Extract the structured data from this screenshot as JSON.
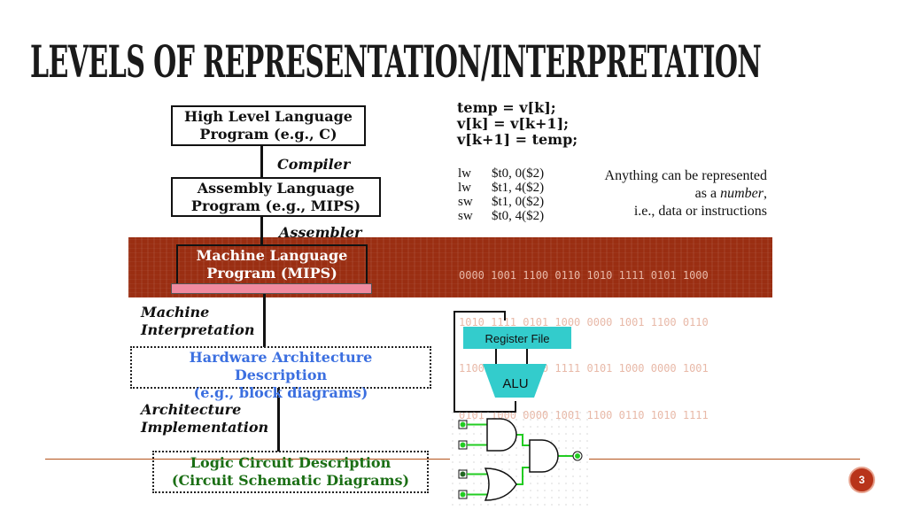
{
  "slide": {
    "title": "LEVELS OF REPRESENTATION/INTERPRETATION",
    "page_number": "3"
  },
  "hierarchy": {
    "high_level": [
      "High Level Language",
      "Program (e.g., C)"
    ],
    "compiler": "Compiler",
    "assembly": [
      "Assembly  Language",
      "Program (e.g., MIPS)"
    ],
    "assembler": "Assembler",
    "machine": [
      "Machine  Language",
      "Program (MIPS)"
    ],
    "machine_interp": [
      "Machine",
      "Interpretation"
    ],
    "hardware": [
      "Hardware Architecture",
      "Description",
      "(e.g., block diagrams)"
    ],
    "arch_impl": [
      "Architecture",
      "Implementation"
    ],
    "logic": [
      "Logic Circuit Description",
      "(Circuit Schematic Diagrams)"
    ]
  },
  "c_code": [
    "temp = v[k];",
    "v[k] = v[k+1];",
    "v[k+1] = temp;"
  ],
  "asm_code": [
    {
      "op": "lw",
      "args": "$t0, 0($2)"
    },
    {
      "op": "lw",
      "args": "$t1, 4($2)"
    },
    {
      "op": "sw",
      "args": "$t1, 0($2)"
    },
    {
      "op": "sw",
      "args": "$t0, 4($2)"
    }
  ],
  "note": {
    "line1": "Anything can be represented",
    "line2_prefix": "as a ",
    "line2_em": "number",
    "line2_suffix": ",",
    "line3": "i.e., data or instructions"
  },
  "binary": [
    "0000 1001 1100 0110 1010 1111 0101 1000",
    "1010 1111 0101 1000 0000 1001 1100 0110",
    "1100 0110 1010 1111 0101 1000 0000 1001",
    "0101 1000 0000 1001 1100 0110 1010 1111"
  ],
  "block_diagram": {
    "register_file": "Register File",
    "alu": "ALU"
  },
  "colors": {
    "band": "#9a2e12",
    "teal": "#33cccc",
    "blue_text": "#3b6fe0",
    "green_text": "#1a6e14",
    "wire_green": "#22cc22",
    "accent_line": "#b5531c",
    "badge": "#b8341a"
  }
}
